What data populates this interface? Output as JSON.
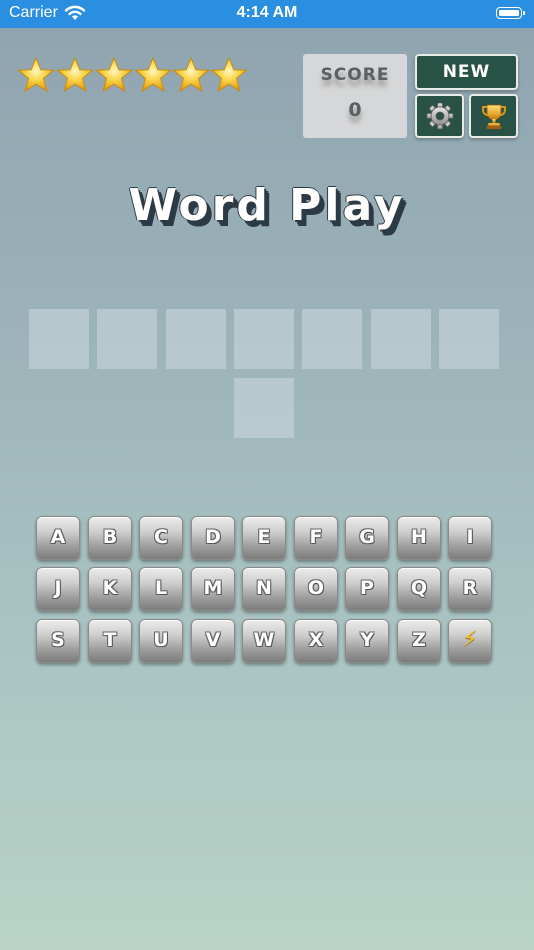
{
  "status_bar": {
    "carrier": "Carrier",
    "time": "4:14 AM"
  },
  "stars": {
    "count": 6,
    "color": "#f5c518"
  },
  "score": {
    "label": "SCORE",
    "value": "0"
  },
  "buttons": {
    "new_label": "NEW",
    "settings_icon": "gear-icon",
    "leaderboard_icon": "trophy-icon"
  },
  "title": "Word Play",
  "answer": {
    "slot_count": 8,
    "letters": [
      "",
      "",
      "",
      "",
      "",
      "",
      "",
      ""
    ]
  },
  "keyboard": {
    "rows": [
      [
        "A",
        "B",
        "C",
        "D",
        "E",
        "F",
        "G",
        "H",
        "I"
      ],
      [
        "J",
        "K",
        "L",
        "M",
        "N",
        "O",
        "P",
        "Q",
        "R"
      ],
      [
        "S",
        "T",
        "U",
        "V",
        "W",
        "X",
        "Y",
        "Z",
        "⚡"
      ]
    ],
    "hint_icon": "lightning-bolt-icon"
  },
  "colors": {
    "status_bar": "#2a8fe0",
    "button_dark_green": "#285245",
    "score_box": "#d6d7d8"
  }
}
